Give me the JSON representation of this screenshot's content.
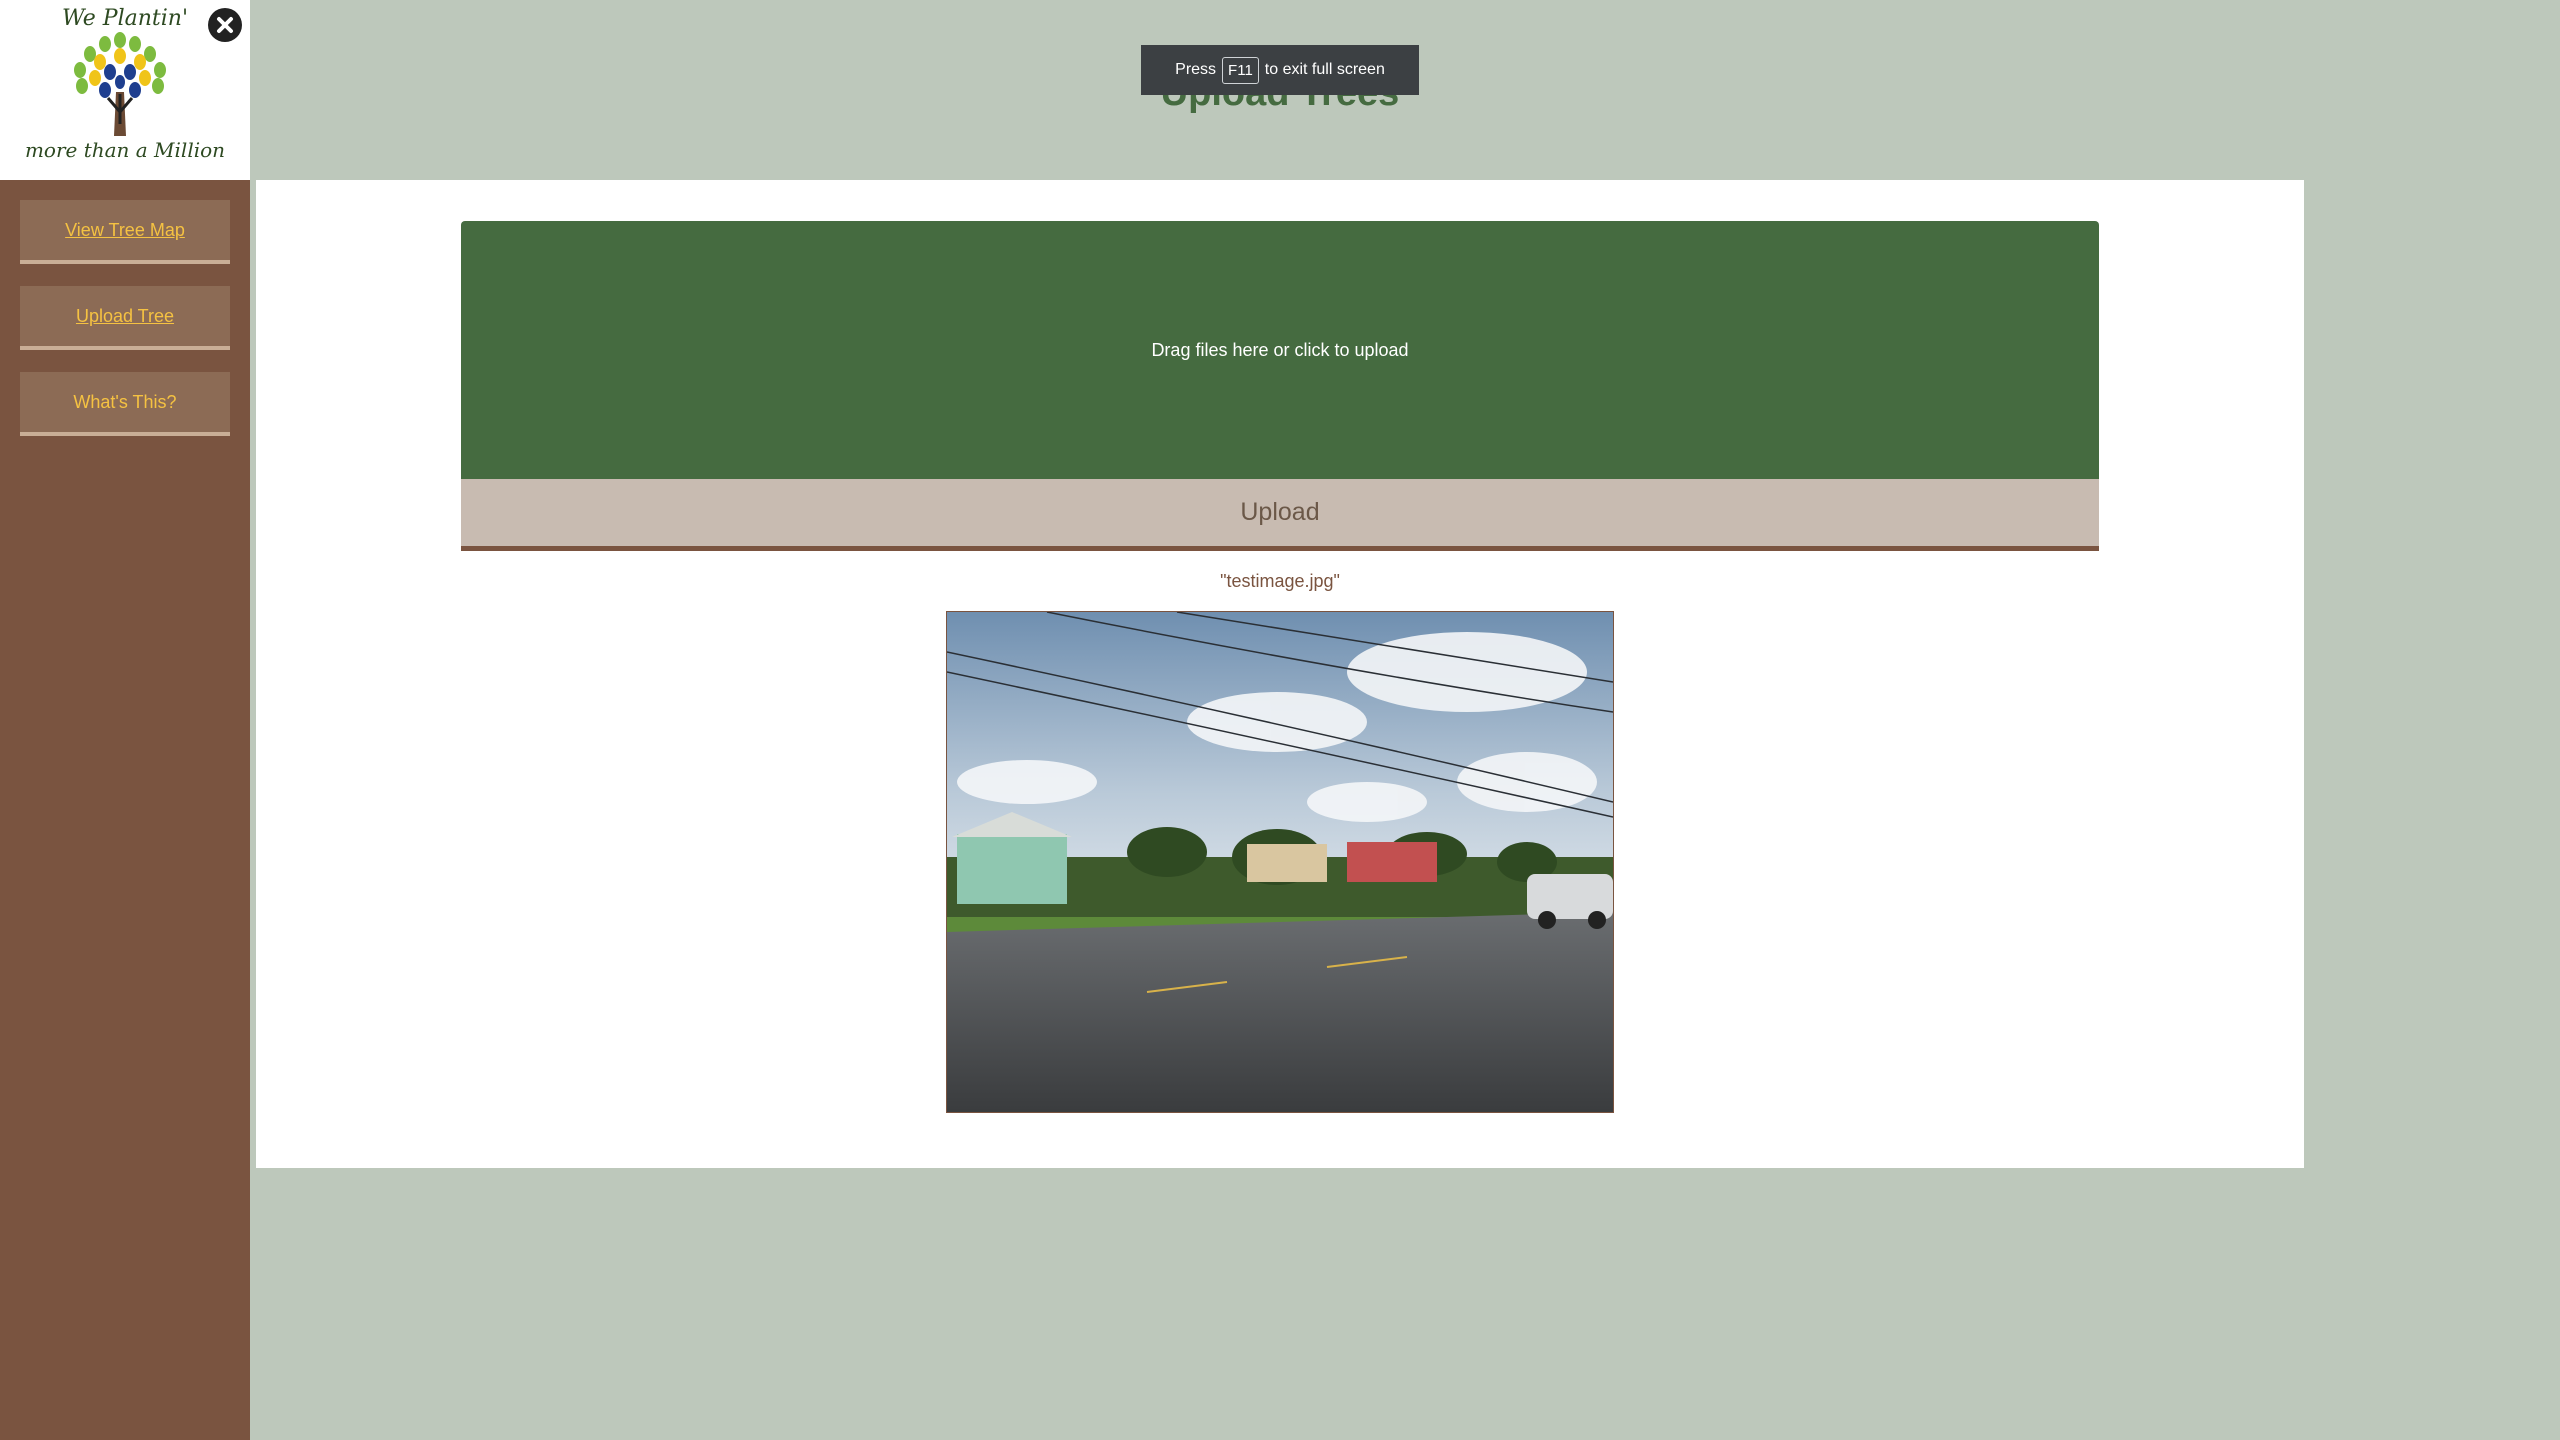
{
  "sidebar": {
    "logo": {
      "title": "We Plantin'",
      "subtitle": "more than a Million"
    },
    "close_icon": "close-icon",
    "items": [
      {
        "label": "View Tree Map"
      },
      {
        "label": "Upload Tree"
      },
      {
        "label": "What's This?"
      }
    ]
  },
  "header": {
    "title": "Upload Trees"
  },
  "fullscreen_toast": {
    "before": "Press",
    "key": "F11",
    "after": "to exit full screen"
  },
  "upload": {
    "dropzone_text": "Drag files here or click to upload",
    "button_label": "Upload",
    "file_name": "\"testimage.jpg\""
  },
  "colors": {
    "page_bg": "#bdc8bb",
    "sidebar_bg": "#7a5440",
    "accent_green": "#456b40",
    "nav_text": "#f5c242"
  }
}
